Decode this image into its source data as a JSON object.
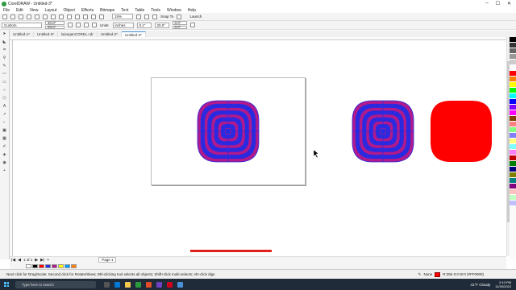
{
  "titlebar": {
    "title": "CorelDRAW - Untitled-3*"
  },
  "menu": [
    "File",
    "Edit",
    "View",
    "Layout",
    "Object",
    "Effects",
    "Bitmaps",
    "Text",
    "Table",
    "Tools",
    "Window",
    "Help"
  ],
  "toolbar": {
    "zoom": "15%",
    "snap_to": "Snap To",
    "launch": "Launch"
  },
  "propbar": {
    "page_size": "Custom",
    "width": "40.0\"",
    "height": "20.0\"",
    "units_label": "Units:",
    "units": "inches",
    "nudge": "0.1\"",
    "angle": "20.0°",
    "dup_x": "0.0\"",
    "dup_y": "0.0\""
  },
  "tabs": [
    "Untitled-1*",
    "Untitled-3*",
    "laiseganCOREL.cdr",
    "Untitled-2*",
    "Untitled-3*"
  ],
  "pagebar": {
    "counter": "1 of 1",
    "page_tab": "Page 1"
  },
  "status": {
    "hint": "Next click for Drag/Scale; Second click for Rotate/Skew; Dbl-clicking tool selects all objects; Shift+click multi-selects; Alt+click digs",
    "outline": "None",
    "fill": "R:255 G:0 B:0 (#FF0000)",
    "fill_color": "#FF0000"
  },
  "taskbar": {
    "search": "Type here to search",
    "weather": "41°F Cloudy",
    "time": "2:10 PM",
    "date": "11/30/2022"
  },
  "colors": {
    "flower_fill": "#b01a8c",
    "flower_stroke": "#2a2ae0",
    "solid_flower": "#ff0000",
    "accent": "#e0201a"
  },
  "palette": [
    "#000000",
    "#333333",
    "#666666",
    "#999999",
    "#cccccc",
    "#ffffff",
    "#ff0000",
    "#ff7f00",
    "#ffff00",
    "#00ff00",
    "#00ffff",
    "#0000ff",
    "#8000ff",
    "#ff00ff",
    "#804000",
    "#ff8080",
    "#80ff80",
    "#8080ff",
    "#ffff80",
    "#80ffff",
    "#ff80ff",
    "#c00000",
    "#008000",
    "#000080",
    "#808000",
    "#008080",
    "#800080",
    "#ffc0c0",
    "#c0ffc0",
    "#c0c0ff"
  ],
  "doc_palette": [
    "#ffffff",
    "#000000",
    "#ff0000",
    "#2a2ae0",
    "#b01a8c",
    "#ffff00",
    "#00a0ff",
    "#ff8000"
  ]
}
